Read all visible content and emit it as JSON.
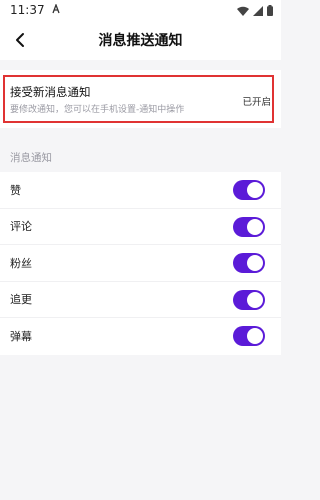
{
  "status_bar": {
    "time": "11:37",
    "notification_icon": "a-icon"
  },
  "nav": {
    "title": "消息推送通知"
  },
  "accept": {
    "title": "接受新消息通知",
    "subtitle": "要修改通知，您可以在手机设置-通知中操作",
    "status": "已开启"
  },
  "section": {
    "label": "消息通知"
  },
  "items": [
    {
      "label": "赞",
      "enabled": true
    },
    {
      "label": "评论",
      "enabled": true
    },
    {
      "label": "粉丝",
      "enabled": true
    },
    {
      "label": "追更",
      "enabled": true
    },
    {
      "label": "弹幕",
      "enabled": true
    }
  ],
  "colors": {
    "toggle_on": "#5b1bd8",
    "highlight_border": "#e03333"
  }
}
